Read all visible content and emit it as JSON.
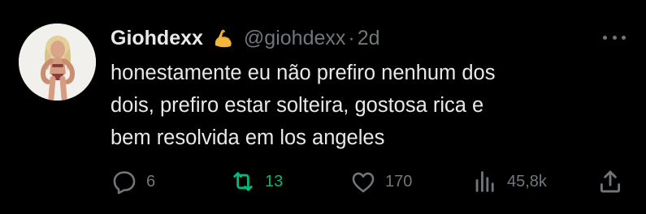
{
  "author": {
    "display_name": "Giohdexx",
    "badge_icon": "flexed-biceps-emoji",
    "handle": "@giohdexx",
    "separator": "·",
    "time": "2d"
  },
  "tweet": {
    "lines": [
      "honestamente eu não prefiro nenhum dos",
      "dois, prefiro estar solteira, gostosa rica e",
      "bem resolvida em los angeles"
    ]
  },
  "actions": {
    "reply": {
      "icon": "reply-icon",
      "count": "6"
    },
    "retweet": {
      "icon": "retweet-icon",
      "count": "13",
      "active": true,
      "color": "#00ba7c"
    },
    "like": {
      "icon": "heart-icon",
      "count": "170"
    },
    "views": {
      "icon": "views-icon",
      "count": "45,8k"
    },
    "share": {
      "icon": "share-icon"
    }
  },
  "colors": {
    "background": "#000000",
    "primary_text": "#e7e9ea",
    "secondary_text": "#71767b",
    "retweet_active": "#00ba7c"
  }
}
